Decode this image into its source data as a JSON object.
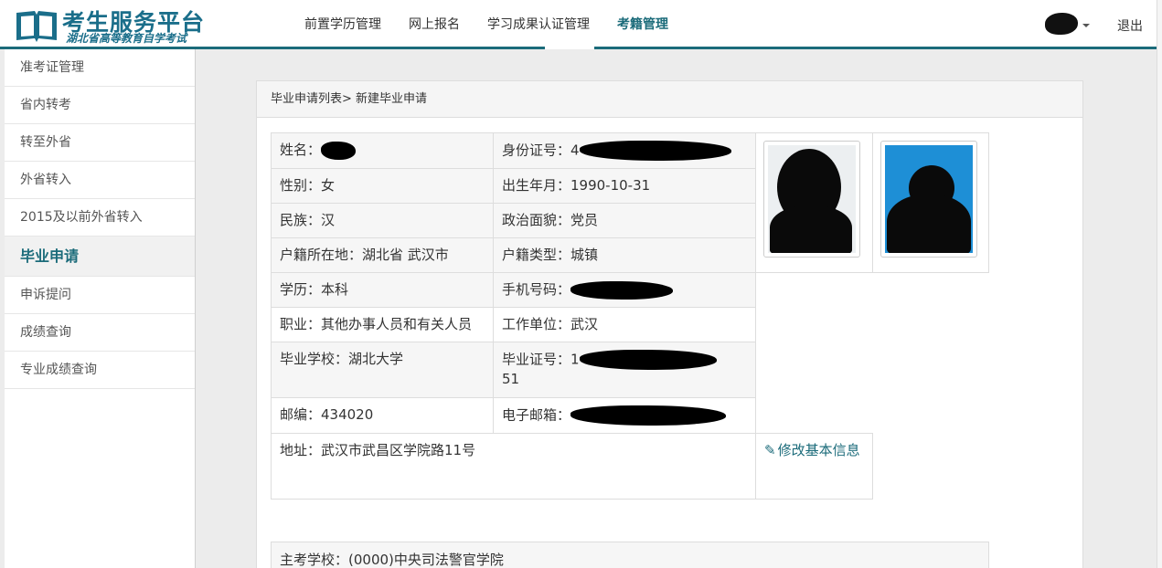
{
  "header": {
    "logo_title": "考生服务平台",
    "logo_subtitle": "湖北省高等教育自学考试",
    "nav": [
      "前置学历管理",
      "网上报名",
      "学习成果认证管理",
      "考籍管理"
    ],
    "active_nav": "考籍管理",
    "logout": "退出"
  },
  "sidebar": {
    "items": [
      "准考证管理",
      "省内转考",
      "转至外省",
      "外省转入",
      "2015及以前外省转入",
      "毕业申请",
      "申诉提问",
      "成绩查询",
      "专业成绩查询"
    ],
    "active": "毕业申请"
  },
  "breadcrumb": "毕业申请列表> 新建毕业申请",
  "info": {
    "name_label": "姓名：",
    "id_label": "身份证号：",
    "id_visible": "4",
    "gender": "性别：女",
    "birth": "出生年月：1990-10-31",
    "ethnicity": "民族：汉",
    "political": "政治面貌：党员",
    "hukou_location": "户籍所在地：湖北省 武汉市",
    "hukou_type": "户籍类型：城镇",
    "education": "学历：本科",
    "phone_label": "手机号码：",
    "occupation": "职业：其他办事人员和有关人员",
    "employer": "工作单位：武汉",
    "school": "毕业学校：湖北大学",
    "cert_label": "毕业证号：",
    "cert_visible_start": "1",
    "cert_visible_end": "51",
    "postcode": "邮编：434020",
    "email_label": "电子邮箱：",
    "address": "地址：武汉市武昌区学院路11号",
    "edit_link": "修改基本信息"
  },
  "main_school": "主考学校：(0000)中央司法警官学院",
  "colors": {
    "brand": "#1b6b7a",
    "photo_bg": "#1e8fd6"
  },
  "icons": [
    "book-logo-icon",
    "caret-down-icon",
    "pencil-icon"
  ]
}
